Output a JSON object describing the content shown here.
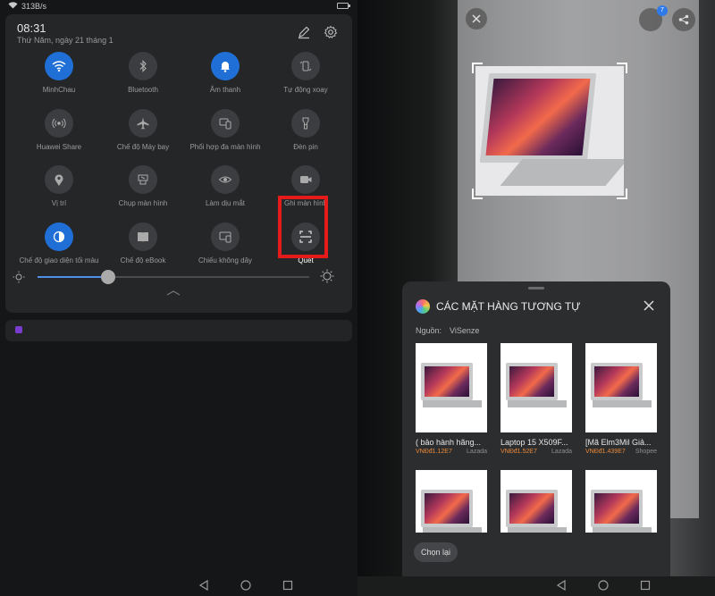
{
  "status": {
    "rate": "313B/s"
  },
  "qs": {
    "time": "08:31",
    "date": "Thứ Năm, ngày 21 tháng 1",
    "tiles": [
      {
        "label": "MinhChau",
        "icon": "wifi-icon",
        "on": true
      },
      {
        "label": "Bluetooth",
        "icon": "bluetooth-icon",
        "on": false
      },
      {
        "label": "Âm thanh",
        "icon": "bell-icon",
        "on": true
      },
      {
        "label": "Tự động xoay",
        "icon": "rotate-icon",
        "on": false
      },
      {
        "label": "Huawei Share",
        "icon": "share-wave-icon",
        "on": false
      },
      {
        "label": "Chế độ Máy bay",
        "icon": "airplane-icon",
        "on": false
      },
      {
        "label": "Phối hợp đa màn hình",
        "icon": "multiscreen-icon",
        "on": false
      },
      {
        "label": "Đèn pin",
        "icon": "flashlight-icon",
        "on": false
      },
      {
        "label": "Vị trí",
        "icon": "location-icon",
        "on": false
      },
      {
        "label": "Chụp màn hình",
        "icon": "screenshot-icon",
        "on": false
      },
      {
        "label": "Làm dịu mắt",
        "icon": "eye-icon",
        "on": false
      },
      {
        "label": "Ghi màn hình",
        "icon": "record-icon",
        "on": false
      },
      {
        "label": "Chế độ giao diện tối màu",
        "icon": "dark-mode-icon",
        "on": true
      },
      {
        "label": "Chế độ eBook",
        "icon": "ebook-icon",
        "on": false
      },
      {
        "label": "Chiếu không dây",
        "icon": "cast-icon",
        "on": false
      },
      {
        "label": "Quét",
        "icon": "scan-icon",
        "on": false
      }
    ],
    "brightness": 0.26
  },
  "sheet": {
    "title": "CÁC MẶT HÀNG TƯƠNG TỰ",
    "source_label": "Nguồn:",
    "source_value": "ViSenze",
    "reselect": "Chọn lại",
    "results": [
      {
        "name": "( bảo hành hãng...",
        "price": "VNĐđ1.12E7",
        "store": "Lazada"
      },
      {
        "name": "Laptop  15 X509F...",
        "price": "VNĐđ1.52E7",
        "store": "Lazada"
      },
      {
        "name": "[Mã Elm3Mil Giả...",
        "price": "VNĐđ1.439E7",
        "store": "Shopee"
      },
      {
        "name": "",
        "price": "",
        "store": ""
      },
      {
        "name": "",
        "price": "",
        "store": ""
      },
      {
        "name": "",
        "price": "",
        "store": ""
      }
    ],
    "badge_count": "7"
  }
}
